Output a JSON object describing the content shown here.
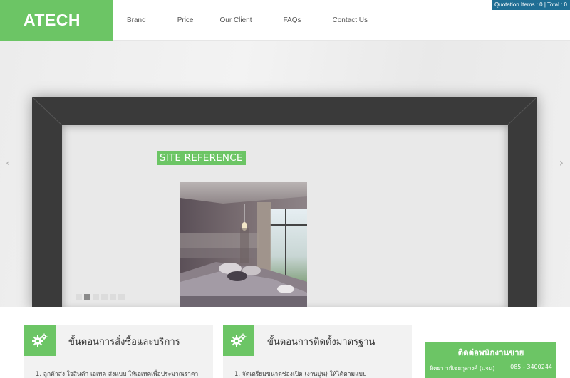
{
  "header": {
    "logo": "ATECH",
    "nav": [
      "Brand",
      "Price",
      "Our Client",
      "FAQs",
      "Contact Us"
    ],
    "quotation": "Quotation Items : 0 | Total : 0"
  },
  "hero": {
    "prev_arrow": "‹",
    "next_arrow": "›",
    "badge": "SITE REFERENCE",
    "slide_count": 6,
    "active_slide": 2
  },
  "sections": [
    {
      "title": "ขั้นตอนการสั่งซื้อและบริการ",
      "line1": "1.  ลูกค้าส่ง ใจสินค้า เอเทค  ส่งแบบ ให้เอเทคเพื่อประมาณราคา",
      "line2": ""
    },
    {
      "title": "ขั้นตอนการติดตั้งมาตรฐาน",
      "line1": "1. จัดเตรียมขนาดช่องเปิด (งานปูน) ให้ได้ตามแบบ",
      "line2": ""
    }
  ],
  "contact": {
    "title": "ติดต่อพนักงานขาย",
    "name": "ทิศยา วณิชยกุลวงศ์ (แจน)",
    "phone": "085 - 3400244"
  },
  "colors": {
    "brand_green": "#6cc565",
    "quote_blue": "#1f6e94",
    "frame_dark": "#3a3a3a"
  },
  "icons": {
    "section_icon": "gears-icon",
    "prev": "chevron-left-icon",
    "next": "chevron-right-icon"
  }
}
